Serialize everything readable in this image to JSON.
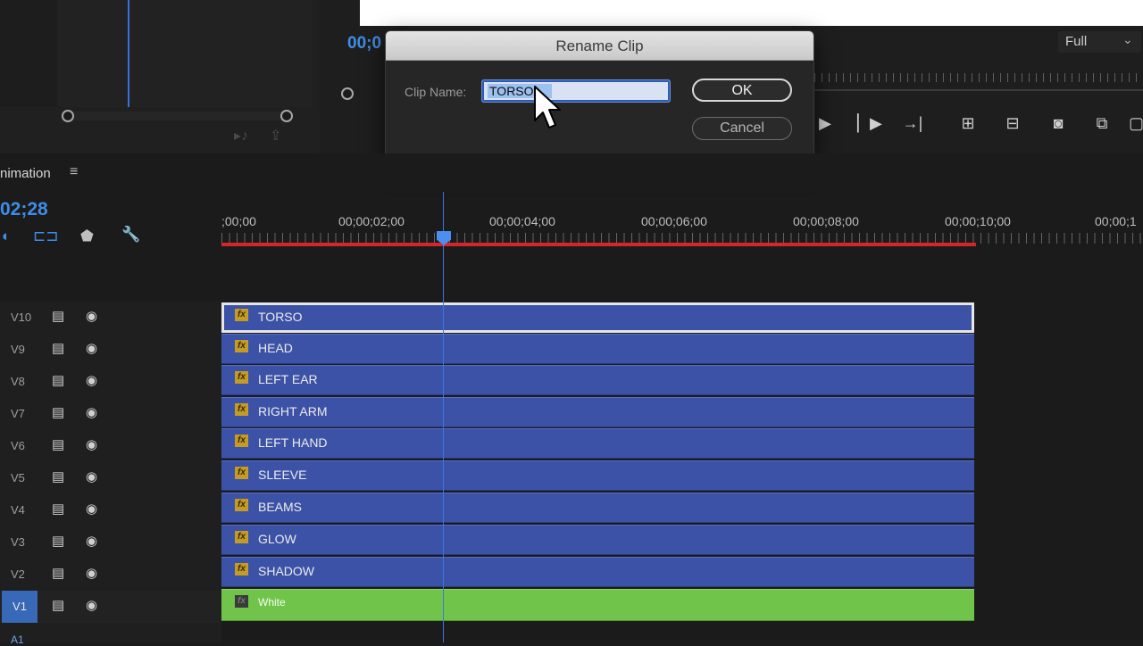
{
  "program": {
    "timecode": "00;0",
    "zoom": "Full"
  },
  "dialog": {
    "title": "Rename Clip",
    "clip_name_label": "Clip Name:",
    "clip_name_value": "TORSO",
    "ok_label": "OK",
    "cancel_label": "Cancel"
  },
  "timeline": {
    "sequence_title": "nimation",
    "timecode": "02;28",
    "ruler_labels": [
      ";00;00",
      "00;00;02;00",
      "00;00;04;00",
      "00;00;06;00",
      "00;00;08;00",
      "00;00;10;00",
      "00;00;1"
    ],
    "tracks": [
      {
        "id": "V10",
        "clip": "TORSO"
      },
      {
        "id": "V9",
        "clip": "HEAD"
      },
      {
        "id": "V8",
        "clip": "LEFT EAR"
      },
      {
        "id": "V7",
        "clip": "RIGHT ARM"
      },
      {
        "id": "V6",
        "clip": "LEFT HAND"
      },
      {
        "id": "V5",
        "clip": "SLEEVE"
      },
      {
        "id": "V4",
        "clip": "BEAMS"
      },
      {
        "id": "V3",
        "clip": "GLOW"
      },
      {
        "id": "V2",
        "clip": "SHADOW"
      },
      {
        "id": "V1",
        "clip": "White"
      }
    ],
    "audio_track": "A1",
    "fx_badge": "fx"
  },
  "colors": {
    "accent_blue": "#3f8ce6",
    "clip_blue": "#3c52a6",
    "clip_green": "#71c44a",
    "work_area_red": "#d6262a",
    "fx_gold": "#c49b25"
  },
  "icons": [
    "eye-icon",
    "sync-lock-icon",
    "marker-icon",
    "wrench-icon",
    "snap-icon",
    "play-icon",
    "step-forward-icon",
    "go-to-out-icon",
    "lift-icon",
    "extract-icon",
    "camera-icon",
    "compare-icon",
    "menu-icon",
    "chevron-down-icon",
    "cursor-icon"
  ]
}
